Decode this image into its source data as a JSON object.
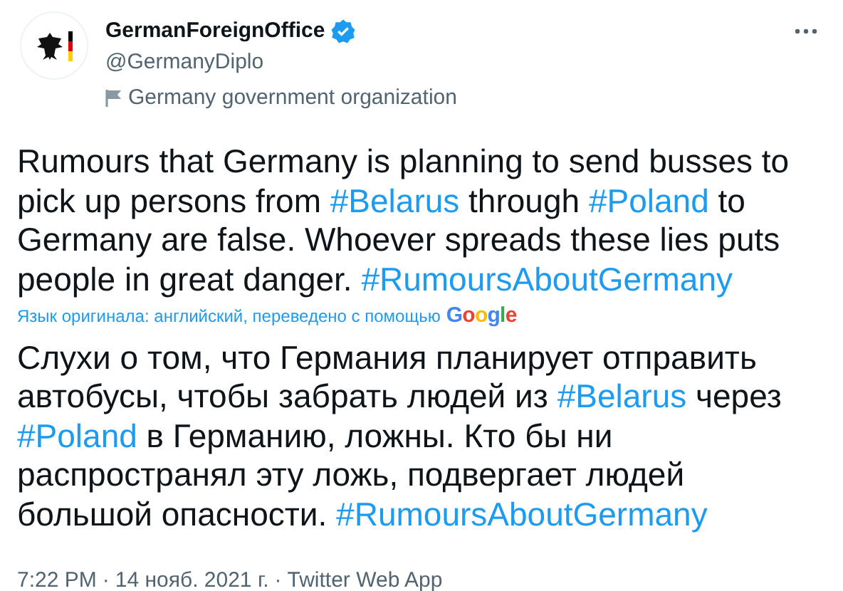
{
  "author": {
    "name": "GermanForeignOffice",
    "verified": true,
    "handle": "@GermanyDiplo",
    "label": "Germany government organization"
  },
  "tweet": {
    "original": [
      {
        "kind": "text",
        "text": "Rumours that Germany is planning to send busses to pick up persons from "
      },
      {
        "kind": "hashtag",
        "text": "#Belarus"
      },
      {
        "kind": "text",
        "text": " through "
      },
      {
        "kind": "hashtag",
        "text": "#Poland"
      },
      {
        "kind": "text",
        "text": " to Germany are false. Whoever spreads these lies puts people in great danger. "
      },
      {
        "kind": "hashtag",
        "text": "#RumoursAboutGermany"
      }
    ],
    "translation_note": "Язык оригинала: английский, переведено с помощью",
    "translator_logo": "Google",
    "translated": [
      {
        "kind": "text",
        "text": "Слухи о том, что Германия планирует отправить автобусы, чтобы забрать людей из "
      },
      {
        "kind": "hashtag",
        "text": "#Belarus"
      },
      {
        "kind": "text",
        "text": " через "
      },
      {
        "kind": "hashtag",
        "text": "#Poland"
      },
      {
        "kind": "text",
        "text": " в Германию, ложны. Кто бы ни распространял эту ложь, подвергает людей большой опасности. "
      },
      {
        "kind": "hashtag",
        "text": "#RumoursAboutGermany"
      }
    ]
  },
  "meta": {
    "time": "7:22 PM",
    "date": "14 нояб. 2021 г.",
    "source": "Twitter Web App",
    "separator": "·"
  }
}
